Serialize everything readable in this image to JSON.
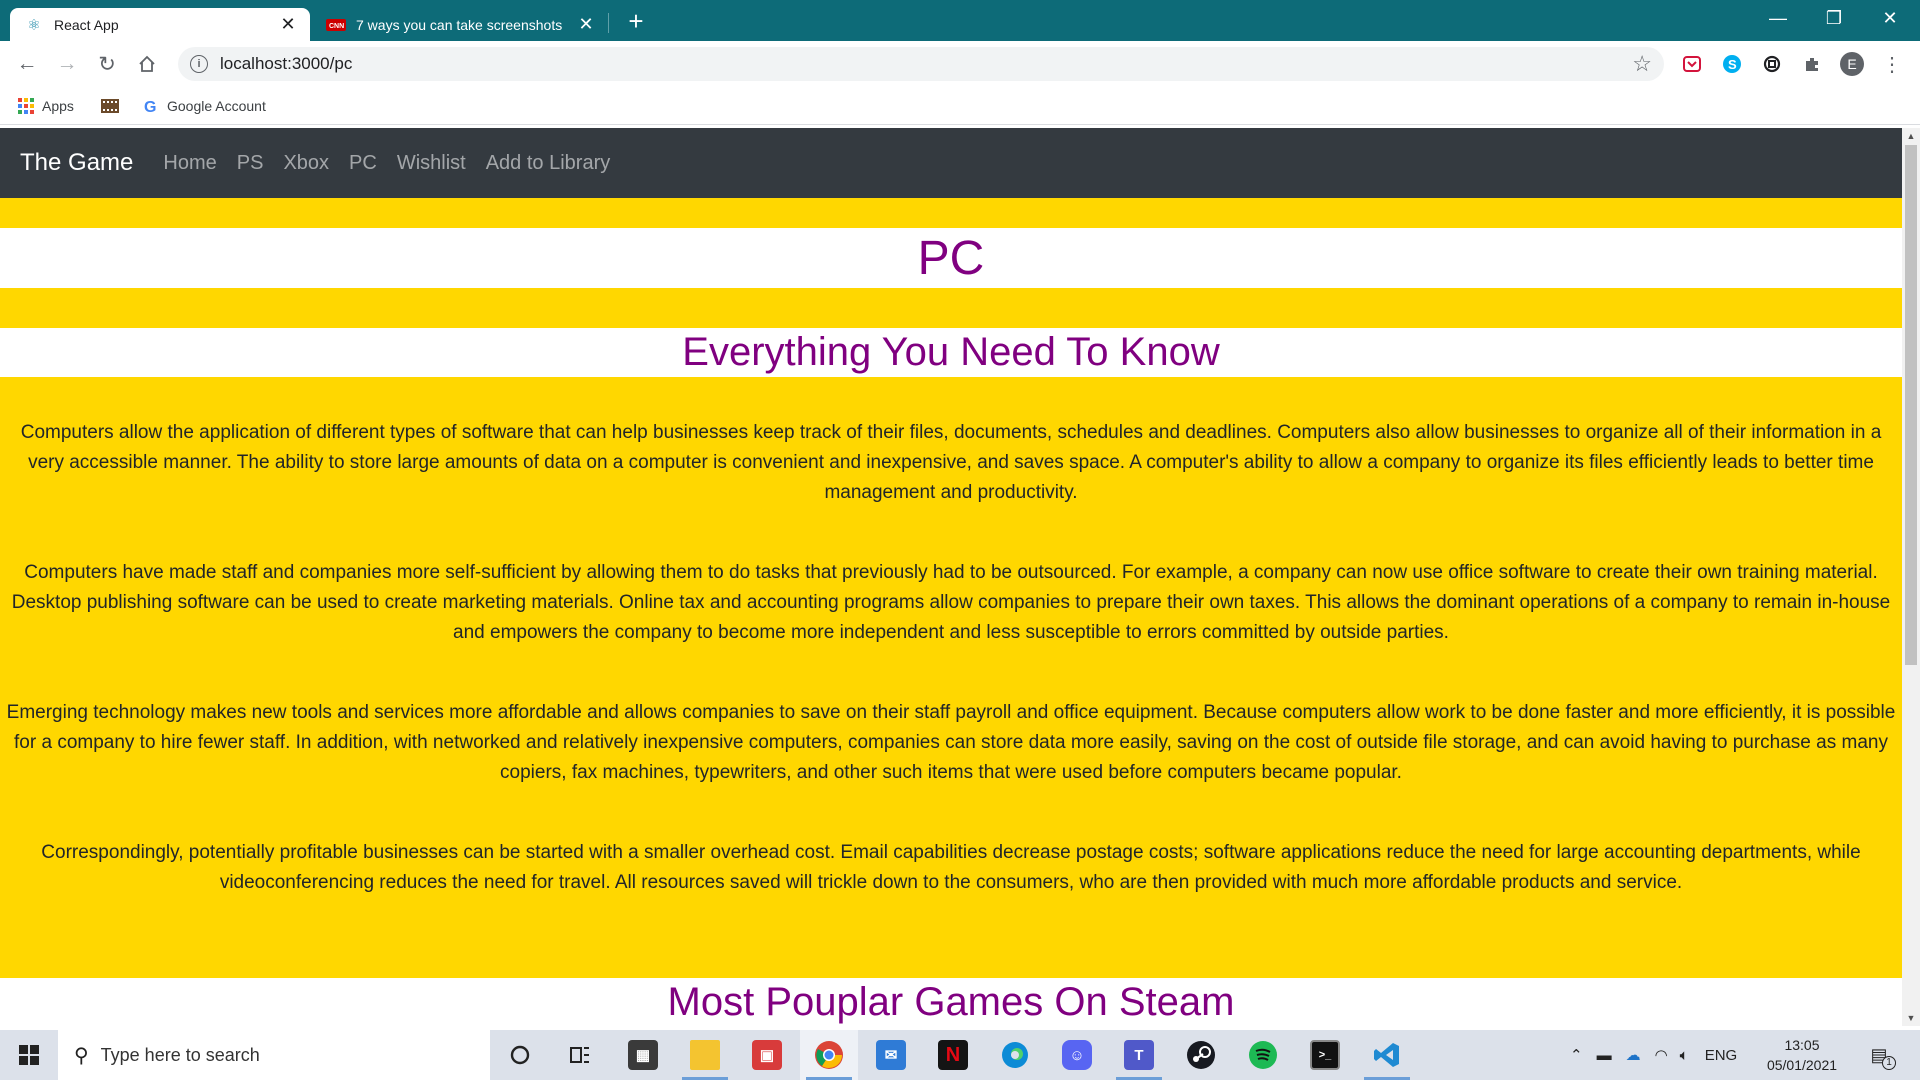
{
  "browser": {
    "tabs": [
      {
        "label": "React App",
        "active": true,
        "icon": "react-icon"
      },
      {
        "label": "7 ways you can take screenshots",
        "active": false,
        "icon": "cnn-icon"
      }
    ],
    "new_tab": "+",
    "window_controls": {
      "minimize": "—",
      "restore": "❐",
      "close": "✕"
    },
    "url": "localhost:3000/pc",
    "profile_initial": "E",
    "bookmarks": [
      {
        "label": "Apps",
        "icon": "apps-grid-icon"
      },
      {
        "label": "",
        "icon": "film-icon"
      },
      {
        "label": "Google Account",
        "icon": "google-icon"
      }
    ]
  },
  "page": {
    "navbar": {
      "brand": "The Game",
      "links": [
        "Home",
        "PS",
        "Xbox",
        "PC",
        "Wishlist",
        "Add to Library"
      ]
    },
    "title": "PC",
    "subtitle": "Everything You Need To Know",
    "paragraphs": [
      "Computers allow the application of different types of software that can help businesses keep track of their files, documents, schedules and deadlines. Computers also allow businesses to organize all of their information in a very accessible manner. The ability to store large amounts of data on a computer is convenient and inexpensive, and saves space. A computer's ability to allow a company to organize its files efficiently leads to better time management and productivity.",
      "Computers have made staff and companies more self-sufficient by allowing them to do tasks that previously had to be outsourced. For example, a company can now use office software to create their own training material. Desktop publishing software can be used to create marketing materials. Online tax and accounting programs allow companies to prepare their own taxes. This allows the dominant operations of a company to remain in-house and empowers the company to become more independent and less susceptible to errors committed by outside parties.",
      "Emerging technology makes new tools and services more affordable and allows companies to save on their staff payroll and office equipment. Because computers allow work to be done faster and more efficiently, it is possible for a company to hire fewer staff. In addition, with networked and relatively inexpensive computers, companies can store data more easily, saving on the cost of outside file storage, and can avoid having to purchase as many copiers, fax machines, typewriters, and other such items that were used before computers became popular.",
      "Correspondingly, potentially profitable businesses can be started with a smaller overhead cost. Email capabilities decrease postage costs; software applications reduce the need for large accounting departments, while videoconferencing reduces the need for travel. All resources saved will trickle down to the consumers, who are then provided with much more affordable products and service."
    ],
    "section2_title": "Most Pouplar Games On Steam"
  },
  "taskbar": {
    "search_placeholder": "Type here to search",
    "language": "ENG",
    "time": "13:05",
    "date": "05/01/2021",
    "notification_count": "1"
  },
  "colors": {
    "page_background": "#ffd700",
    "heading": "#800080",
    "navbar": "#343a40",
    "tab_strip": "#0d6b78"
  }
}
